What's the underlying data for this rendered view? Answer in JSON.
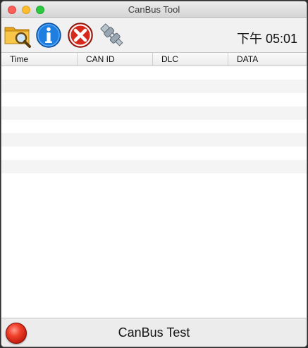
{
  "window": {
    "title": "CanBus Tool"
  },
  "toolbar": {
    "buttons": [
      {
        "name": "open-folder",
        "icon": "folder-search-icon"
      },
      {
        "name": "info",
        "icon": "info-icon"
      },
      {
        "name": "stop",
        "icon": "close-circle-icon"
      },
      {
        "name": "connect",
        "icon": "plug-connector-icon"
      }
    ],
    "clock": "下午 05:01"
  },
  "table": {
    "columns": [
      "Time",
      "CAN ID",
      "DLC",
      "DATA"
    ],
    "rows": []
  },
  "status": {
    "indicator_color": "#e3301e",
    "text": "CanBus Test"
  }
}
